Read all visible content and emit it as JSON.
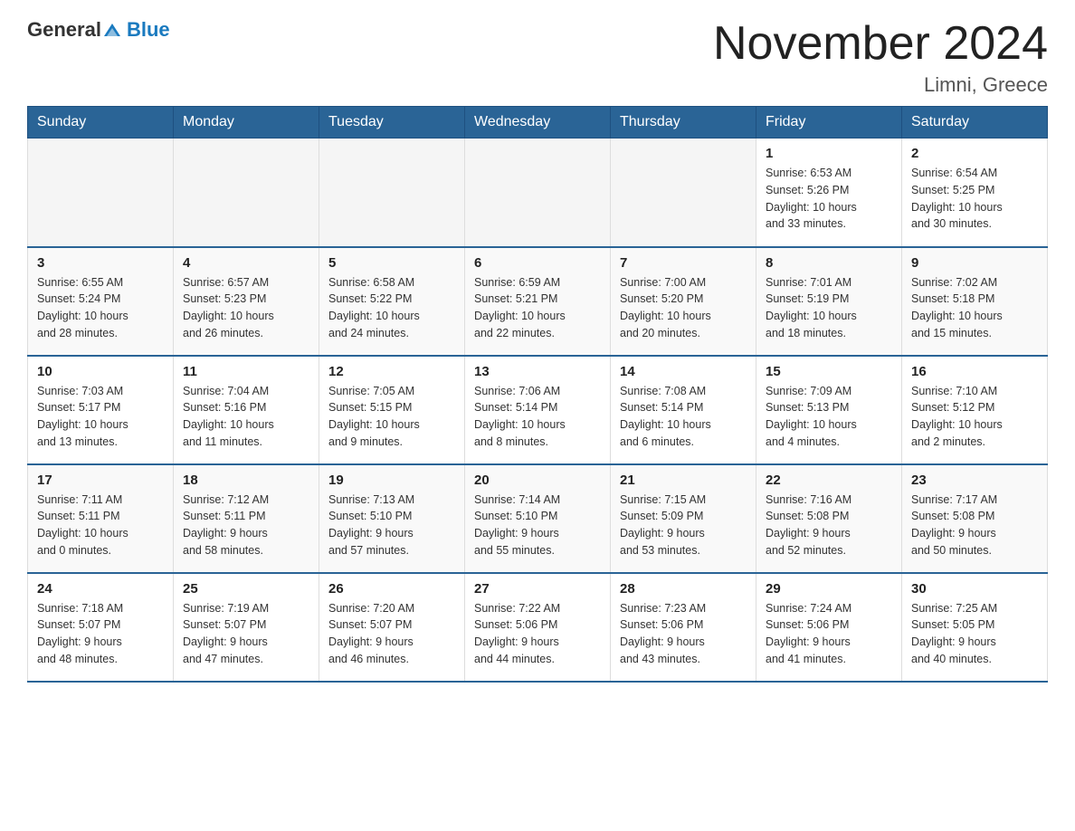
{
  "header": {
    "logo_general": "General",
    "logo_blue": "Blue",
    "month_title": "November 2024",
    "location": "Limni, Greece"
  },
  "days_of_week": [
    "Sunday",
    "Monday",
    "Tuesday",
    "Wednesday",
    "Thursday",
    "Friday",
    "Saturday"
  ],
  "weeks": [
    {
      "cells": [
        {
          "day": "",
          "info": ""
        },
        {
          "day": "",
          "info": ""
        },
        {
          "day": "",
          "info": ""
        },
        {
          "day": "",
          "info": ""
        },
        {
          "day": "",
          "info": ""
        },
        {
          "day": "1",
          "info": "Sunrise: 6:53 AM\nSunset: 5:26 PM\nDaylight: 10 hours\nand 33 minutes."
        },
        {
          "day": "2",
          "info": "Sunrise: 6:54 AM\nSunset: 5:25 PM\nDaylight: 10 hours\nand 30 minutes."
        }
      ]
    },
    {
      "cells": [
        {
          "day": "3",
          "info": "Sunrise: 6:55 AM\nSunset: 5:24 PM\nDaylight: 10 hours\nand 28 minutes."
        },
        {
          "day": "4",
          "info": "Sunrise: 6:57 AM\nSunset: 5:23 PM\nDaylight: 10 hours\nand 26 minutes."
        },
        {
          "day": "5",
          "info": "Sunrise: 6:58 AM\nSunset: 5:22 PM\nDaylight: 10 hours\nand 24 minutes."
        },
        {
          "day": "6",
          "info": "Sunrise: 6:59 AM\nSunset: 5:21 PM\nDaylight: 10 hours\nand 22 minutes."
        },
        {
          "day": "7",
          "info": "Sunrise: 7:00 AM\nSunset: 5:20 PM\nDaylight: 10 hours\nand 20 minutes."
        },
        {
          "day": "8",
          "info": "Sunrise: 7:01 AM\nSunset: 5:19 PM\nDaylight: 10 hours\nand 18 minutes."
        },
        {
          "day": "9",
          "info": "Sunrise: 7:02 AM\nSunset: 5:18 PM\nDaylight: 10 hours\nand 15 minutes."
        }
      ]
    },
    {
      "cells": [
        {
          "day": "10",
          "info": "Sunrise: 7:03 AM\nSunset: 5:17 PM\nDaylight: 10 hours\nand 13 minutes."
        },
        {
          "day": "11",
          "info": "Sunrise: 7:04 AM\nSunset: 5:16 PM\nDaylight: 10 hours\nand 11 minutes."
        },
        {
          "day": "12",
          "info": "Sunrise: 7:05 AM\nSunset: 5:15 PM\nDaylight: 10 hours\nand 9 minutes."
        },
        {
          "day": "13",
          "info": "Sunrise: 7:06 AM\nSunset: 5:14 PM\nDaylight: 10 hours\nand 8 minutes."
        },
        {
          "day": "14",
          "info": "Sunrise: 7:08 AM\nSunset: 5:14 PM\nDaylight: 10 hours\nand 6 minutes."
        },
        {
          "day": "15",
          "info": "Sunrise: 7:09 AM\nSunset: 5:13 PM\nDaylight: 10 hours\nand 4 minutes."
        },
        {
          "day": "16",
          "info": "Sunrise: 7:10 AM\nSunset: 5:12 PM\nDaylight: 10 hours\nand 2 minutes."
        }
      ]
    },
    {
      "cells": [
        {
          "day": "17",
          "info": "Sunrise: 7:11 AM\nSunset: 5:11 PM\nDaylight: 10 hours\nand 0 minutes."
        },
        {
          "day": "18",
          "info": "Sunrise: 7:12 AM\nSunset: 5:11 PM\nDaylight: 9 hours\nand 58 minutes."
        },
        {
          "day": "19",
          "info": "Sunrise: 7:13 AM\nSunset: 5:10 PM\nDaylight: 9 hours\nand 57 minutes."
        },
        {
          "day": "20",
          "info": "Sunrise: 7:14 AM\nSunset: 5:10 PM\nDaylight: 9 hours\nand 55 minutes."
        },
        {
          "day": "21",
          "info": "Sunrise: 7:15 AM\nSunset: 5:09 PM\nDaylight: 9 hours\nand 53 minutes."
        },
        {
          "day": "22",
          "info": "Sunrise: 7:16 AM\nSunset: 5:08 PM\nDaylight: 9 hours\nand 52 minutes."
        },
        {
          "day": "23",
          "info": "Sunrise: 7:17 AM\nSunset: 5:08 PM\nDaylight: 9 hours\nand 50 minutes."
        }
      ]
    },
    {
      "cells": [
        {
          "day": "24",
          "info": "Sunrise: 7:18 AM\nSunset: 5:07 PM\nDaylight: 9 hours\nand 48 minutes."
        },
        {
          "day": "25",
          "info": "Sunrise: 7:19 AM\nSunset: 5:07 PM\nDaylight: 9 hours\nand 47 minutes."
        },
        {
          "day": "26",
          "info": "Sunrise: 7:20 AM\nSunset: 5:07 PM\nDaylight: 9 hours\nand 46 minutes."
        },
        {
          "day": "27",
          "info": "Sunrise: 7:22 AM\nSunset: 5:06 PM\nDaylight: 9 hours\nand 44 minutes."
        },
        {
          "day": "28",
          "info": "Sunrise: 7:23 AM\nSunset: 5:06 PM\nDaylight: 9 hours\nand 43 minutes."
        },
        {
          "day": "29",
          "info": "Sunrise: 7:24 AM\nSunset: 5:06 PM\nDaylight: 9 hours\nand 41 minutes."
        },
        {
          "day": "30",
          "info": "Sunrise: 7:25 AM\nSunset: 5:05 PM\nDaylight: 9 hours\nand 40 minutes."
        }
      ]
    }
  ]
}
